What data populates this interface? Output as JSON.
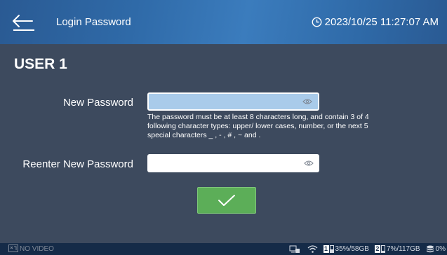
{
  "header": {
    "title": "Login Password",
    "datetime": "2023/10/25 11:27:07 AM"
  },
  "user": {
    "label": "USER 1"
  },
  "new_password": {
    "label": "New Password",
    "value": "",
    "hint": "The password must be at least 8 characters long, and contain 3 of 4 following character types: upper/ lower cases, number, or the next 5 special characters  _ , - , # , ~ and ."
  },
  "reenter_password": {
    "label": "Reenter New Password",
    "value": ""
  },
  "confirm": {
    "icon": "check-icon"
  },
  "statusbar": {
    "video": "NO VIDEO",
    "disk1": {
      "badge": "1",
      "text": "35%/58GB"
    },
    "disk2": {
      "badge": "2",
      "text": "7%/117GB"
    },
    "storage": "0%"
  },
  "colors": {
    "header": "#2f6aa8",
    "background": "#3d4a5e",
    "focused_input": "#a9cbea",
    "confirm": "#5cae58",
    "statusbar": "#152b48"
  }
}
